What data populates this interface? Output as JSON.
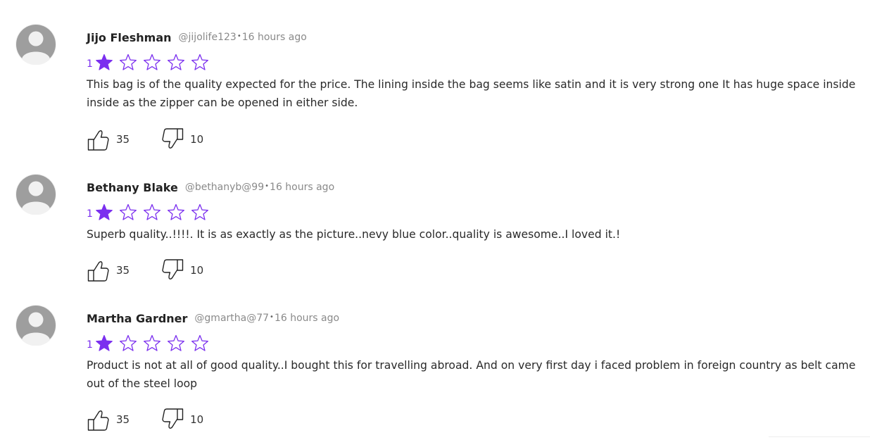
{
  "reviews": [
    {
      "name": "Jijo Fleshman",
      "handle": "@jijolife123",
      "separator": "•",
      "time": "16 hours ago",
      "rating": "1",
      "rating_value": 1,
      "rating_max": 5,
      "text": "This bag is of the quality expected for the price. The lining inside the bag seems like satin and it is very strong one It has huge space inside inside as the zipper can be opened in either side.",
      "likes": "35",
      "dislikes": "10"
    },
    {
      "name": "Bethany Blake",
      "handle": "@bethanyb@99",
      "separator": "•",
      "time": "16 hours ago",
      "rating": "1",
      "rating_value": 1,
      "rating_max": 5,
      "text": "Superb quality..!!!!. It is as exactly as the picture..nevy blue color..quality is awesome..I loved it.!",
      "likes": "35",
      "dislikes": "10"
    },
    {
      "name": "Martha Gardner",
      "handle": "@gmartha@77",
      "separator": "•",
      "time": "16 hours ago",
      "rating": "1",
      "rating_value": 1,
      "rating_max": 5,
      "text": "Product is not at all of good quality..I bought this for travelling abroad. And on very first day i faced problem in foreign country as belt came out of the steel loop",
      "likes": "35",
      "dislikes": "10"
    }
  ],
  "colors": {
    "accent": "#7b2fef",
    "avatar": "#9e9e9e",
    "avatar_bg": "#f1f1f1",
    "muted": "#8a8a8a"
  },
  "icons": {
    "avatar": "user-avatar-icon",
    "star_filled": "star-filled-icon",
    "star_empty": "star-outline-icon",
    "like": "thumbs-up-icon",
    "dislike": "thumbs-down-icon"
  }
}
